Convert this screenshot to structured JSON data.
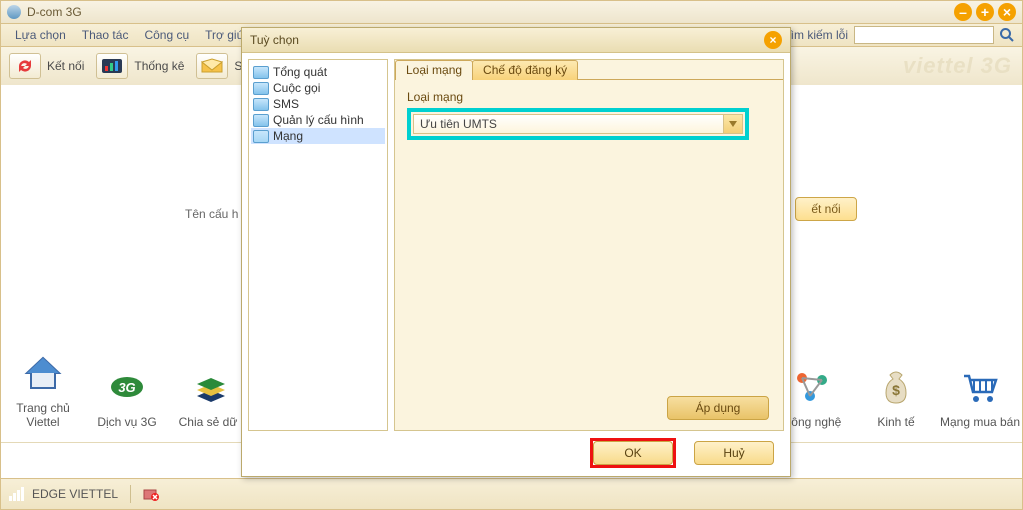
{
  "app": {
    "title": "D-com 3G"
  },
  "menu": {
    "items": [
      "Lựa chọn",
      "Thao tác",
      "Công cụ",
      "Trợ giúp"
    ]
  },
  "search": {
    "label": "Tìm kiếm lỗi",
    "value": ""
  },
  "toolbar": {
    "connect": "Kết nối",
    "stats": "Thống kê",
    "s": "S"
  },
  "brand": "viettel 3G",
  "background": {
    "config_label": "Tên cấu h",
    "connect_btn": "ết nối"
  },
  "launcher": {
    "left": [
      {
        "label": "Trang chủ Viettel"
      },
      {
        "label": "Dịch vụ 3G"
      },
      {
        "label": "Chia sẻ dữ l"
      }
    ],
    "right": [
      {
        "label": "Công nghệ"
      },
      {
        "label": "Kinh tế"
      },
      {
        "label": "Mạng mua bán"
      }
    ]
  },
  "status": {
    "network": "EDGE  VIETTEL"
  },
  "dialog": {
    "title": "Tuỳ chọn",
    "tree": [
      {
        "label": "Tổng quát",
        "open": false
      },
      {
        "label": "Cuộc gọi",
        "open": false
      },
      {
        "label": "SMS",
        "open": false
      },
      {
        "label": "Quản lý cấu hình",
        "open": false
      },
      {
        "label": "Mạng",
        "open": true,
        "selected": true
      }
    ],
    "tabs": [
      {
        "label": "Loại mạng",
        "active": true
      },
      {
        "label": "Chế độ đăng ký",
        "active": false
      }
    ],
    "group_label": "Loại mạng",
    "combo_value": "Ưu tiên UMTS",
    "apply": "Áp dụng",
    "ok": "OK",
    "cancel": "Huỷ"
  }
}
